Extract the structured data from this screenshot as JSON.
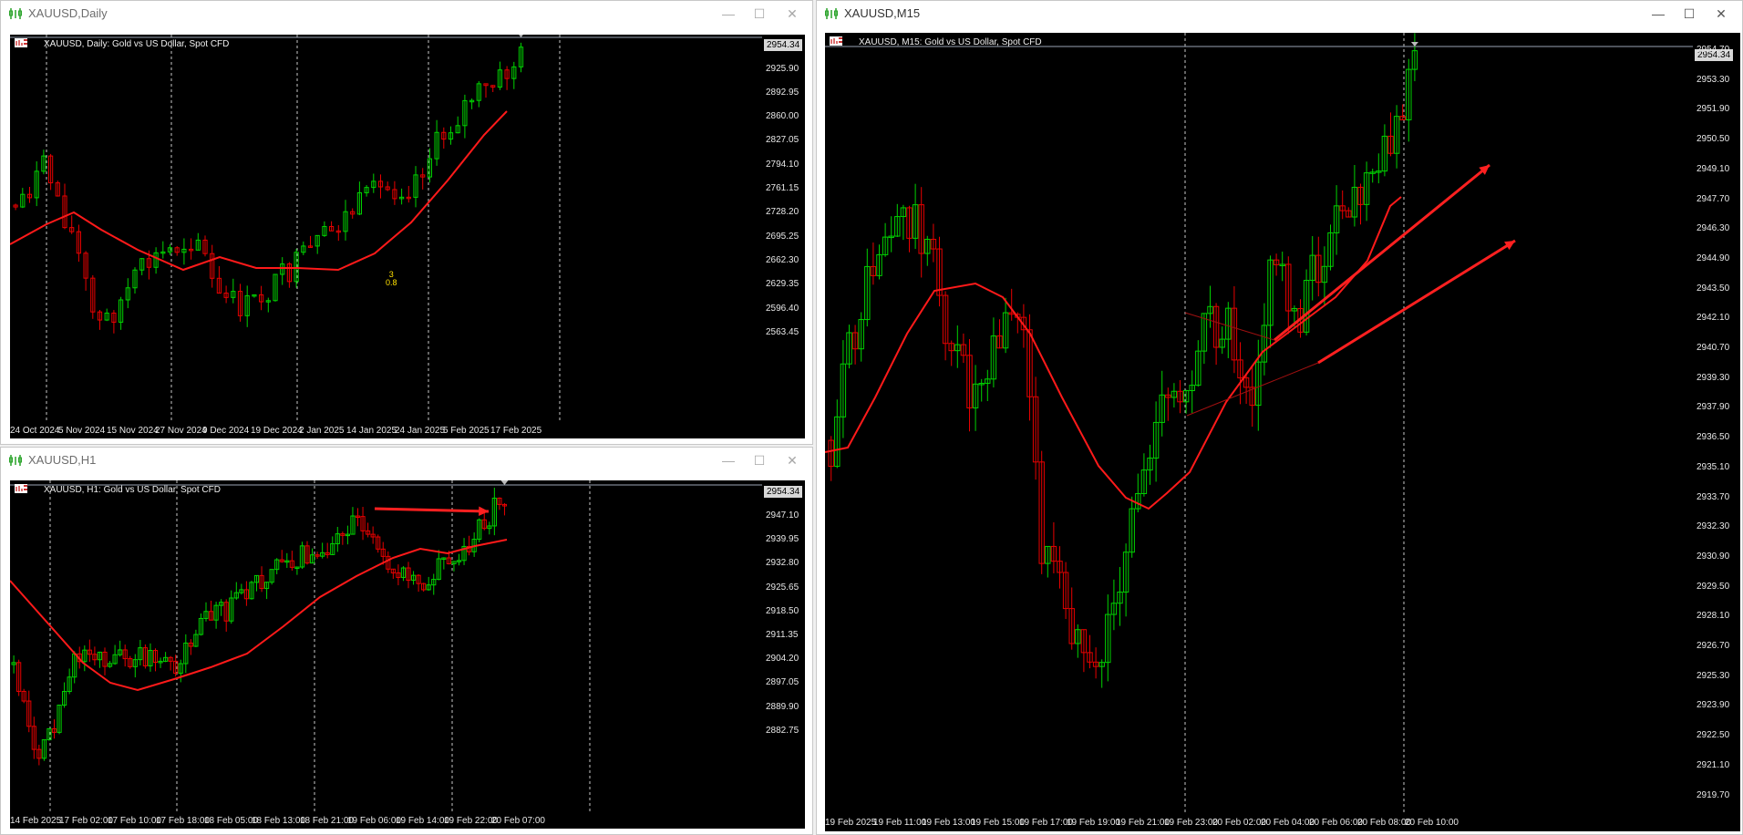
{
  "colors": {
    "bull": "#00d200",
    "bear": "#e80000",
    "ma": "#ff1a1a",
    "grid": "#c8c8c8",
    "bid": "#9aa5b5"
  },
  "windows": [
    {
      "id": "daily",
      "title": "XAUUSD,Daily",
      "active": false,
      "chart_head": "XAUUSD, Daily:  Gold vs US Dollar, Spot CFD",
      "price_tag": "2954.34",
      "scale_labels": [
        "2925.90",
        "2892.95",
        "2860.00",
        "2827.05",
        "2794.10",
        "2761.15",
        "2728.20",
        "2695.25",
        "2662.30",
        "2629.35",
        "2596.40",
        "2563.45"
      ],
      "time_labels": [
        "24 Oct 2024",
        "5 Nov 2024",
        "15 Nov 2024",
        "27 Nov 2024",
        "9 Dec 2024",
        "19 Dec 2024",
        "2 Jan 2025",
        "14 Jan 2025",
        "24 Jan 2025",
        "5 Feb 2025",
        "17 Feb 2025"
      ],
      "annotation": [
        "3",
        "0.8"
      ],
      "minimize_icon": "minimize-icon",
      "maximize_icon": "maximize-icon",
      "close_icon": "close-icon"
    },
    {
      "id": "h1",
      "title": "XAUUSD,H1",
      "active": false,
      "chart_head": "XAUUSD, H1:  Gold vs US Dollar, Spot CFD",
      "price_tag": "2954.34",
      "scale_labels": [
        "2947.10",
        "2939.95",
        "2932.80",
        "2925.65",
        "2918.50",
        "2911.35",
        "2904.20",
        "2897.05",
        "2889.90",
        "2882.75"
      ],
      "time_labels": [
        "14 Feb 2025",
        "17 Feb 02:00",
        "17 Feb 10:00",
        "17 Feb 18:00",
        "18 Feb 05:00",
        "18 Feb 13:00",
        "18 Feb 21:00",
        "19 Feb 06:00",
        "19 Feb 14:00",
        "19 Feb 22:00",
        "20 Feb 07:00"
      ],
      "minimize_icon": "minimize-icon",
      "maximize_icon": "maximize-icon",
      "close_icon": "close-icon"
    },
    {
      "id": "m15",
      "title": "XAUUSD,M15",
      "active": true,
      "chart_head": "XAUUSD, M15:  Gold vs US Dollar, Spot CFD",
      "price_tag": "2954.34",
      "scale_labels": [
        "2954.70",
        "2953.30",
        "2951.90",
        "2950.50",
        "2949.10",
        "2947.70",
        "2946.30",
        "2944.90",
        "2943.50",
        "2942.10",
        "2940.70",
        "2939.30",
        "2937.90",
        "2936.50",
        "2935.10",
        "2933.70",
        "2932.30",
        "2930.90",
        "2929.50",
        "2928.10",
        "2926.70",
        "2925.30",
        "2923.90",
        "2922.50",
        "2921.10",
        "2919.70"
      ],
      "time_labels": [
        "19 Feb 2025",
        "19 Feb 11:00",
        "19 Feb 13:00",
        "19 Feb 15:00",
        "19 Feb 17:00",
        "19 Feb 19:00",
        "19 Feb 21:00",
        "19 Feb 23:00",
        "20 Feb 02:00",
        "20 Feb 04:00",
        "20 Feb 06:00",
        "20 Feb 08:00",
        "20 Feb 10:00"
      ],
      "minimize_icon": "minimize-icon",
      "maximize_icon": "maximize-icon",
      "close_icon": "close-icon"
    }
  ]
}
